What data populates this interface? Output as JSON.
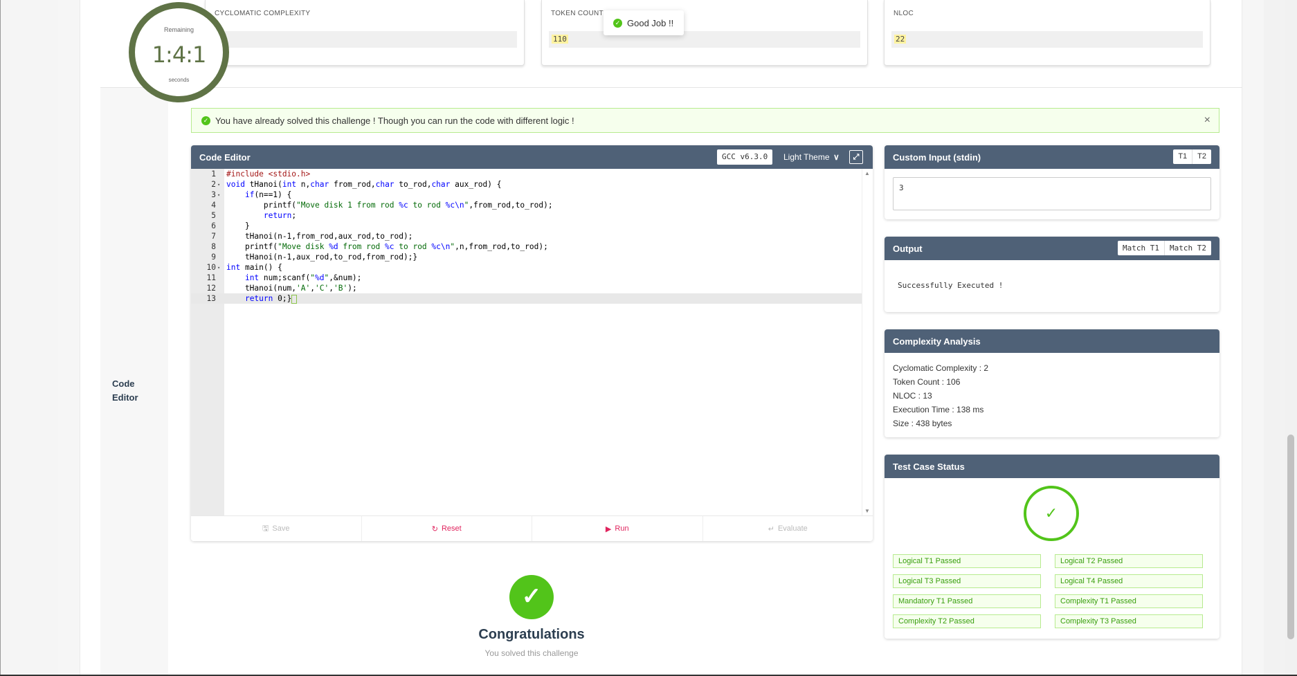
{
  "metrics": [
    {
      "label": "CYCLOMATIC COMPLEXITY",
      "value": "2"
    },
    {
      "label": "TOKEN COUNT",
      "value": "110"
    },
    {
      "label": "NLOC",
      "value": "22"
    }
  ],
  "timer": {
    "label": "Remaining",
    "value": "1:4:1",
    "unit": "seconds"
  },
  "toast": {
    "text": "Good Job !!"
  },
  "alert": {
    "text": "You have already solved this challenge ! Though you can run the code with different logic !",
    "close": "×"
  },
  "side_label": "Code Editor",
  "editor": {
    "title": "Code Editor",
    "compiler": "GCC v6.3.0",
    "theme": "Light Theme",
    "buttons": {
      "save": "Save",
      "reset": "Reset",
      "run": "Run",
      "evaluate": "Evaluate"
    },
    "line_numbers": [
      "1",
      "2",
      "3",
      "4",
      "5",
      "6",
      "7",
      "8",
      "9",
      "10",
      "11",
      "12",
      "13"
    ]
  },
  "stdin": {
    "title": "Custom Input (stdin)",
    "t1": "T1",
    "t2": "T2",
    "value": "3"
  },
  "output": {
    "title": "Output",
    "match_t1": "Match T1",
    "match_t2": "Match T2",
    "text": "Successfully Executed !"
  },
  "complexity": {
    "title": "Complexity Analysis",
    "items": [
      "Cyclomatic Complexity : 2",
      "Token Count : 106",
      "NLOC : 13",
      "Execution Time : 138 ms",
      "Size : 438 bytes"
    ]
  },
  "test_status": {
    "title": "Test Case Status",
    "tags": [
      "Logical T1 Passed",
      "Logical T2 Passed",
      "Logical T3 Passed",
      "Logical T4 Passed",
      "Mandatory T1 Passed",
      "Complexity T1 Passed",
      "Complexity T2 Passed",
      "Complexity T3 Passed"
    ]
  },
  "congrats": {
    "title": "Congratulations",
    "subtitle": "You solved this challenge"
  },
  "colors": {
    "header": "#4f6177",
    "success": "#52c41a",
    "timer": "#5f7346",
    "accent": "#e0245e"
  }
}
